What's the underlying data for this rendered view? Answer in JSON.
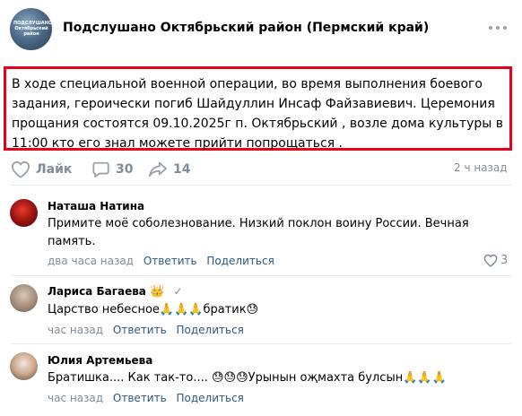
{
  "post": {
    "group_name": "Подслушано Октябрьский район (Пермский край)",
    "avatar_text": "ПОДСЛУШАНО Октябрьский район",
    "text": "В ходе специальной военной операции, во время выполнения боевого задания, героически погиб Шайдуллин Инсаф Файзавиевич. Церемония прощания состоятся 09.10.2025г п. Октябрьский , возле дома культуры в 11:00 кто его знал можете прийти попрощаться .",
    "like_label": "Лайк",
    "comments_count": "30",
    "shares_count": "14",
    "time": "2 ч назад",
    "highlight_color": "#e4001b"
  },
  "comments": [
    {
      "name": "Наташа Натина",
      "text": "Примите моё соболезнование. Низкий поклон воину России. Вечная память.",
      "time": "два часа назад",
      "reply": "Ответить",
      "share": "Поделиться",
      "likes": "3"
    },
    {
      "name": "Лариса Багаева",
      "name_badge": "👑",
      "verified_icon": "✓",
      "text": "Царство небесное🙏🙏🙏братик😓",
      "time": "час назад",
      "reply": "Ответить",
      "share": "Поделиться"
    },
    {
      "name": "Юлия Артемьева",
      "text": "Братишка.... Как так-то.... 😓😓😓Урынын оҗмахта булсын🙏🙏🙏",
      "time": "час назад",
      "reply": "Ответить",
      "share": "Поделиться"
    }
  ]
}
